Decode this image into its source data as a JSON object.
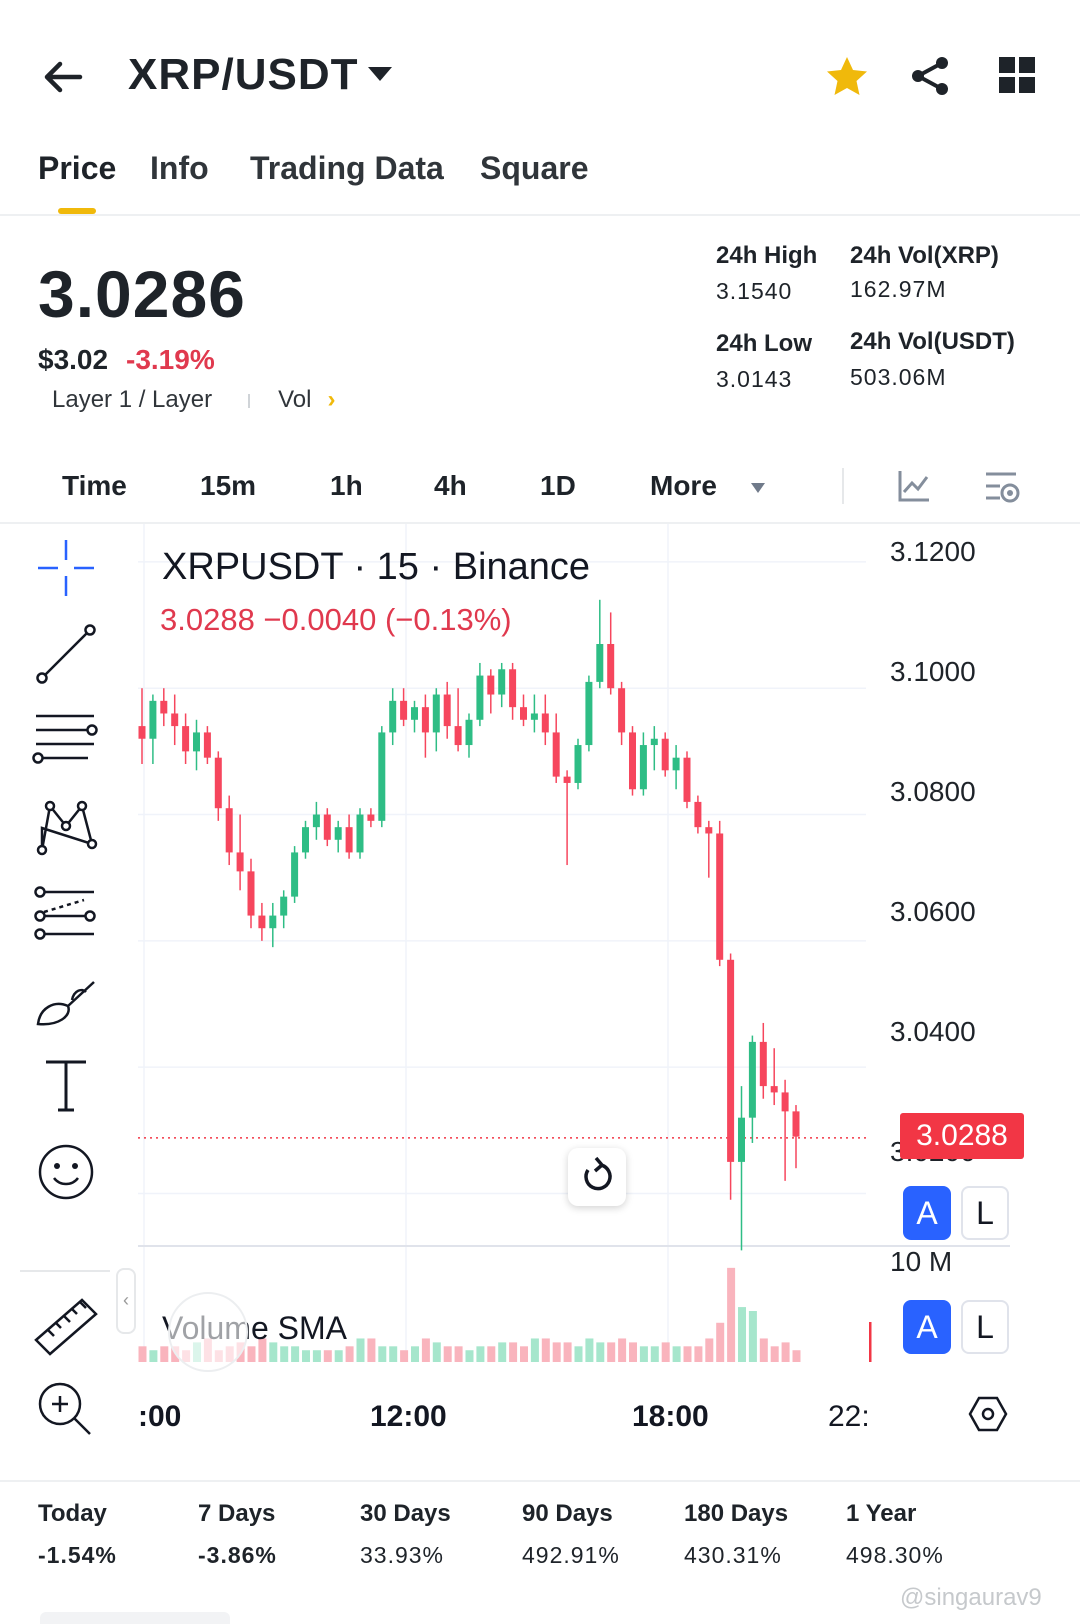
{
  "header": {
    "pair": "XRP/USDT"
  },
  "tabs": [
    {
      "label": "Price"
    },
    {
      "label": "Info"
    },
    {
      "label": "Trading Data"
    },
    {
      "label": "Square"
    }
  ],
  "summary": {
    "price": "3.0286",
    "usd_price": "$3.02",
    "change": "-3.19%",
    "tag": "Layer 1 / Layer",
    "vol_link": "Vol",
    "stats": {
      "high_label": "24h High",
      "high": "3.1540",
      "vol_xrp_label": "24h Vol(XRP)",
      "vol_xrp": "162.97M",
      "low_label": "24h Low",
      "low": "3.0143",
      "vol_usdt_label": "24h Vol(USDT)",
      "vol_usdt": "503.06M"
    }
  },
  "timeframes": [
    "Time",
    "15m",
    "1h",
    "4h",
    "1D",
    "More"
  ],
  "chart": {
    "title": "XRPUSDT · 15 · Binance",
    "ohlc": "3.0288  −0.0040 (−0.13%)",
    "volume_label": "Volume SMA",
    "last_price_tag": "3.0288",
    "price_axis": [
      "3.1200",
      "3.1000",
      "3.0800",
      "3.0600",
      "3.0400",
      "3.0200"
    ],
    "volume_axis": "10 M",
    "time_axis": [
      ":00",
      "12:00",
      "18:00",
      "22:"
    ],
    "auto_label": "A",
    "log_label": "L"
  },
  "chart_data": {
    "type": "candlestick",
    "title": "XRPUSDT · 15 · Binance",
    "ylim": [
      3.012,
      3.126
    ],
    "x_ticks": [
      "12:00",
      "18:00"
    ],
    "last_price": 3.0288,
    "candles": [
      [
        3.094,
        3.1,
        3.088,
        3.092
      ],
      [
        3.092,
        3.099,
        3.088,
        3.098
      ],
      [
        3.098,
        3.1,
        3.094,
        3.096
      ],
      [
        3.096,
        3.099,
        3.091,
        3.094
      ],
      [
        3.094,
        3.096,
        3.088,
        3.09
      ],
      [
        3.09,
        3.095,
        3.087,
        3.093
      ],
      [
        3.093,
        3.094,
        3.088,
        3.089
      ],
      [
        3.089,
        3.09,
        3.079,
        3.081
      ],
      [
        3.081,
        3.083,
        3.072,
        3.074
      ],
      [
        3.074,
        3.08,
        3.068,
        3.071
      ],
      [
        3.071,
        3.073,
        3.062,
        3.064
      ],
      [
        3.064,
        3.066,
        3.06,
        3.062
      ],
      [
        3.062,
        3.066,
        3.059,
        3.064
      ],
      [
        3.064,
        3.068,
        3.062,
        3.067
      ],
      [
        3.067,
        3.075,
        3.066,
        3.074
      ],
      [
        3.074,
        3.079,
        3.073,
        3.078
      ],
      [
        3.078,
        3.082,
        3.076,
        3.08
      ],
      [
        3.08,
        3.081,
        3.075,
        3.076
      ],
      [
        3.076,
        3.079,
        3.074,
        3.078
      ],
      [
        3.078,
        3.08,
        3.073,
        3.074
      ],
      [
        3.074,
        3.081,
        3.073,
        3.08
      ],
      [
        3.08,
        3.081,
        3.078,
        3.079
      ],
      [
        3.079,
        3.094,
        3.078,
        3.093
      ],
      [
        3.093,
        3.1,
        3.091,
        3.098
      ],
      [
        3.098,
        3.1,
        3.094,
        3.095
      ],
      [
        3.095,
        3.098,
        3.093,
        3.097
      ],
      [
        3.097,
        3.099,
        3.089,
        3.093
      ],
      [
        3.093,
        3.1,
        3.09,
        3.099
      ],
      [
        3.099,
        3.101,
        3.092,
        3.094
      ],
      [
        3.094,
        3.1,
        3.09,
        3.091
      ],
      [
        3.091,
        3.096,
        3.089,
        3.095
      ],
      [
        3.095,
        3.104,
        3.094,
        3.102
      ],
      [
        3.102,
        3.103,
        3.096,
        3.099
      ],
      [
        3.099,
        3.104,
        3.097,
        3.103
      ],
      [
        3.103,
        3.104,
        3.095,
        3.097
      ],
      [
        3.097,
        3.099,
        3.094,
        3.095
      ],
      [
        3.095,
        3.099,
        3.093,
        3.096
      ],
      [
        3.096,
        3.099,
        3.091,
        3.093
      ],
      [
        3.093,
        3.096,
        3.085,
        3.086
      ],
      [
        3.086,
        3.087,
        3.072,
        3.085
      ],
      [
        3.085,
        3.092,
        3.084,
        3.091
      ],
      [
        3.091,
        3.102,
        3.09,
        3.101
      ],
      [
        3.101,
        3.114,
        3.1,
        3.107
      ],
      [
        3.107,
        3.112,
        3.099,
        3.1
      ],
      [
        3.1,
        3.101,
        3.091,
        3.093
      ],
      [
        3.093,
        3.094,
        3.083,
        3.084
      ],
      [
        3.084,
        3.093,
        3.083,
        3.091
      ],
      [
        3.091,
        3.094,
        3.087,
        3.092
      ],
      [
        3.092,
        3.093,
        3.086,
        3.087
      ],
      [
        3.087,
        3.091,
        3.084,
        3.089
      ],
      [
        3.089,
        3.09,
        3.081,
        3.082
      ],
      [
        3.082,
        3.083,
        3.077,
        3.078
      ],
      [
        3.078,
        3.079,
        3.07,
        3.077
      ],
      [
        3.077,
        3.079,
        3.056,
        3.057
      ],
      [
        3.057,
        3.058,
        3.019,
        3.025
      ],
      [
        3.025,
        3.037,
        3.011,
        3.032
      ],
      [
        3.032,
        3.045,
        3.028,
        3.044
      ],
      [
        3.044,
        3.047,
        3.035,
        3.037
      ],
      [
        3.037,
        3.043,
        3.034,
        3.036
      ],
      [
        3.036,
        3.038,
        3.022,
        3.033
      ],
      [
        3.033,
        3.034,
        3.024,
        3.029
      ]
    ],
    "volume": [
      2,
      1.5,
      2,
      2,
      1.5,
      2.5,
      3,
      1.5,
      2,
      2.5,
      2,
      3,
      2.5,
      2,
      2,
      1.5,
      1.5,
      1.5,
      1.5,
      2,
      3,
      3,
      2,
      2,
      1.5,
      2,
      3,
      2.5,
      2,
      2,
      1.5,
      2,
      2,
      2.5,
      2.5,
      2,
      3,
      3,
      2.5,
      2.5,
      2,
      3,
      2.5,
      2.5,
      3,
      2.5,
      2,
      2,
      2.5,
      2,
      2,
      2,
      3,
      5,
      12,
      7,
      6.5,
      3,
      2,
      2.5,
      1.5
    ]
  },
  "performance": [
    {
      "label": "Today",
      "value": "-1.54%"
    },
    {
      "label": "7 Days",
      "value": "-3.86%"
    },
    {
      "label": "30 Days",
      "value": "33.93%"
    },
    {
      "label": "90 Days",
      "value": "492.91%"
    },
    {
      "label": "180 Days",
      "value": "430.31%"
    },
    {
      "label": "1 Year",
      "value": "498.30%"
    }
  ],
  "watermark": "@singaurav9",
  "colors": {
    "up": "#2ebd85",
    "down": "#f6465d",
    "accent": "#f0b90b",
    "toggle": "#2962ff"
  }
}
